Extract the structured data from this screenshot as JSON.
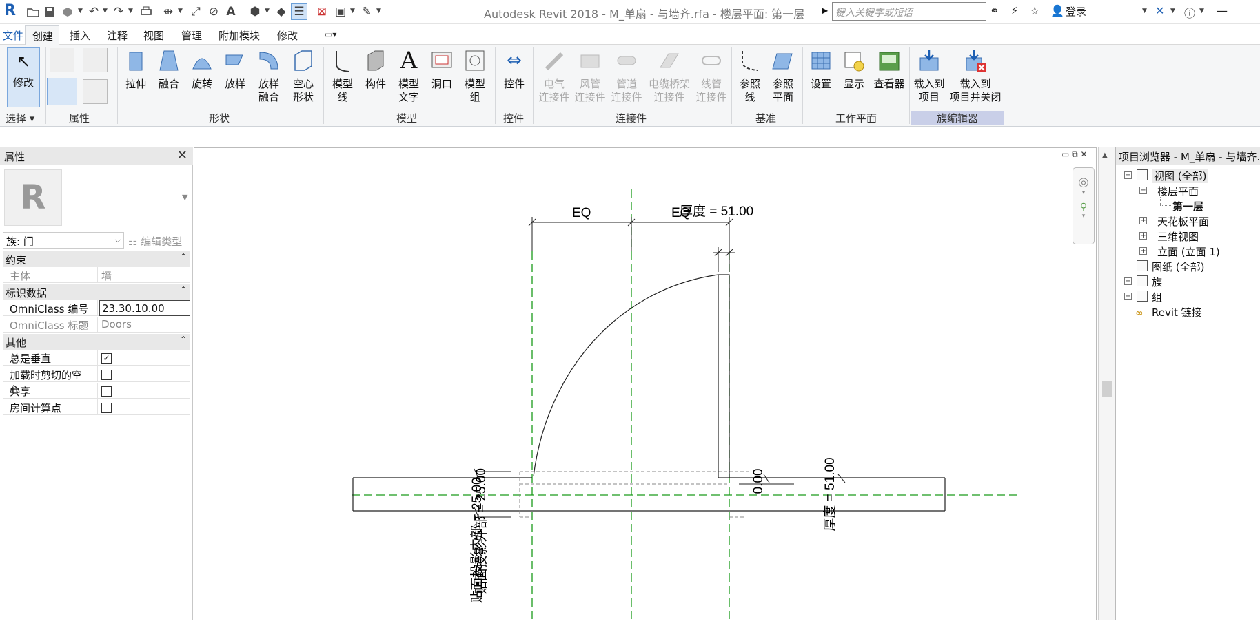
{
  "titlebar": {
    "app_logo": "R",
    "doc_title": "Autodesk Revit 2018 -    M_单扇 - 与墙齐.rfa - 楼层平面: 第一层",
    "search_placeholder": "键入关键字或短语",
    "login_label": "登录",
    "icons": [
      "open-icon",
      "save-icon",
      "sync-icon",
      "undo-icon",
      "redo-icon",
      "print-icon",
      "measure-icon",
      "dimension-icon",
      "tag-icon",
      "text-icon",
      "3d-view-icon",
      "section-icon",
      "thin-lines-icon",
      "close-hidden-icon",
      "switch-windows-icon",
      "customize-icon",
      "binoculars-icon",
      "subscription-icon",
      "favorite-icon",
      "user-icon",
      "x-icon",
      "help-icon"
    ]
  },
  "menubar": {
    "tabs": [
      "文件",
      "创建",
      "插入",
      "注释",
      "视图",
      "管理",
      "附加模块",
      "修改"
    ],
    "active": "创建"
  },
  "ribbon": {
    "select": {
      "modify": "修改",
      "panel": "选择"
    },
    "properties_panel": "属性",
    "forms": {
      "buttons": [
        "拉伸",
        "融合",
        "旋转",
        "放样",
        "放样\n融合",
        "空心\n形状"
      ],
      "panel": "形状"
    },
    "model": {
      "buttons": [
        "模型\n线",
        "构件",
        "模型\n文字",
        "洞口",
        "模型\n组"
      ],
      "panel": "模型"
    },
    "control": {
      "buttons": [
        "控件"
      ],
      "panel": "控件"
    },
    "connectors": {
      "buttons": [
        "电气\n连接件",
        "风管\n连接件",
        "管道\n连接件",
        "电缆桥架\n连接件",
        "线管\n连接件"
      ],
      "panel": "连接件"
    },
    "datum": {
      "buttons": [
        "参照\n线",
        "参照\n平面"
      ],
      "panel": "基准"
    },
    "workplane": {
      "buttons": [
        "设置",
        "显示",
        "查看器"
      ],
      "panel": "工作平面"
    },
    "family_editor": {
      "buttons": [
        "载入到\n项目",
        "载入到\n项目并关闭"
      ],
      "panel": "族编辑器"
    }
  },
  "properties": {
    "title": "属性",
    "family_type": "族: 门",
    "edit_type": "编辑类型",
    "sections": [
      {
        "name": "约束",
        "rows": [
          {
            "key": "主体",
            "value": "墙"
          }
        ]
      },
      {
        "name": "标识数据",
        "rows": [
          {
            "key": "OmniClass 编号",
            "value": "23.30.10.00"
          },
          {
            "key": "OmniClass 标题",
            "value": "Doors"
          }
        ]
      },
      {
        "name": "其他",
        "rows": [
          {
            "key": "总是垂直",
            "checked": true
          },
          {
            "key": "加载时剪切的空心",
            "checked": false
          },
          {
            "key": "共享",
            "checked": false
          },
          {
            "key": "房间计算点",
            "checked": false
          }
        ]
      }
    ]
  },
  "drawing": {
    "dim_thickness_top": "厚度 = 51.00",
    "eq_left": "EQ",
    "eq_right": "EQ",
    "dim_outer": "贴面投影外部 = 25.00",
    "dim_inner": "贴面投影内部 = 25.00",
    "dim_zero": "0.00",
    "dim_thickness_right": "厚度 = 51.00"
  },
  "browser": {
    "title": "项目浏览器 - M_单扇 - 与墙齐.rfa",
    "items": [
      {
        "label": "视图 (全部)",
        "expanded": true
      },
      {
        "label": "楼层平面",
        "expanded": true
      },
      {
        "label": "第一层",
        "bold": true
      },
      {
        "label": "天花板平面",
        "expanded": false
      },
      {
        "label": "三维视图",
        "expanded": false
      },
      {
        "label": "立面 (立面 1)",
        "expanded": false
      },
      {
        "label": "图纸 (全部)"
      },
      {
        "label": "族",
        "expanded": false
      },
      {
        "label": "组",
        "expanded": false
      },
      {
        "label": "Revit 链接"
      }
    ]
  },
  "colors": {
    "accent": "#1d5fb3",
    "guide_green": "#1a9a1a",
    "panel_highlight": "#c9cfe8",
    "ribbon_bg": "#f5f6f7"
  }
}
